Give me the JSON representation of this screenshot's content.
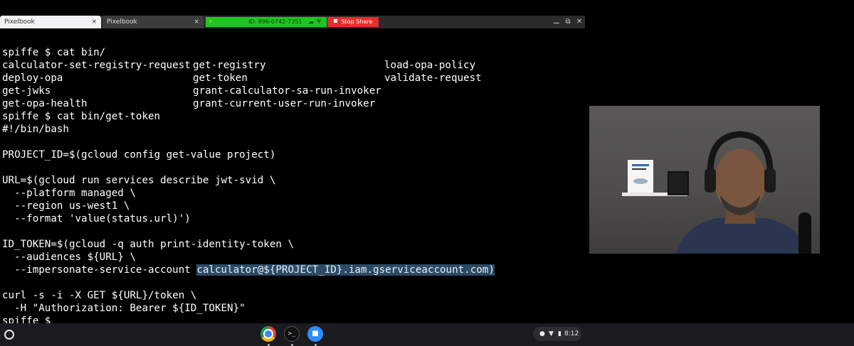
{
  "tabs": [
    {
      "label": "Pixelbook",
      "close": "×"
    },
    {
      "label": "Pixelbook",
      "close": "×"
    }
  ],
  "share": {
    "id_text": "ID: 896-0742-7351",
    "stop_label": "Stop Share"
  },
  "window_controls": {
    "minimize": "⚊",
    "restore": "⧉",
    "close": "✕"
  },
  "terminal": {
    "lines": [
      "spiffe $ cat bin/",
      "",
      "",
      "",
      "",
      "spiffe $ cat bin/get-token",
      "#!/bin/bash",
      "",
      "PROJECT_ID=$(gcloud config get-value project)",
      "",
      "URL=$(gcloud run services describe jwt-svid \\",
      "  --platform managed \\",
      "  --region us-west1 \\",
      "  --format 'value(status.url)')",
      "",
      "ID_TOKEN=$(gcloud -q auth print-identity-token \\",
      "  --audiences ${URL} \\",
      "  --impersonate-service-account ",
      "",
      "curl -s -i -X GET ${URL}/token \\",
      "  -H \"Authorization: Bearer ${ID_TOKEN}\"",
      "spiffe $"
    ],
    "ls_columns": {
      "col1": [
        "calculator-set-registry-request",
        "deploy-opa",
        "get-jwks",
        "get-opa-health"
      ],
      "col2": [
        "get-registry",
        "get-token",
        "grant-calculator-sa-run-invoker",
        "grant-current-user-run-invoker"
      ],
      "col3": [
        "load-opa-policy",
        "validate-request"
      ]
    },
    "highlighted_text": "calculator@${PROJECT_ID}.iam.gserviceaccount.com)"
  },
  "shelf": {
    "book_title": "Kubernetes"
  },
  "taskbar": {
    "apps": [
      {
        "name": "chrome"
      },
      {
        "name": "terminal",
        "glyph": ">_"
      },
      {
        "name": "zoom",
        "glyph": "■"
      }
    ],
    "clock": "8:12",
    "tray_icons": {
      "status": "●",
      "wifi": "▼",
      "battery": "▮"
    }
  },
  "colors": {
    "share_green": "#1fc61f",
    "stop_red": "#e62e2e",
    "highlight": "#2c4a66"
  }
}
